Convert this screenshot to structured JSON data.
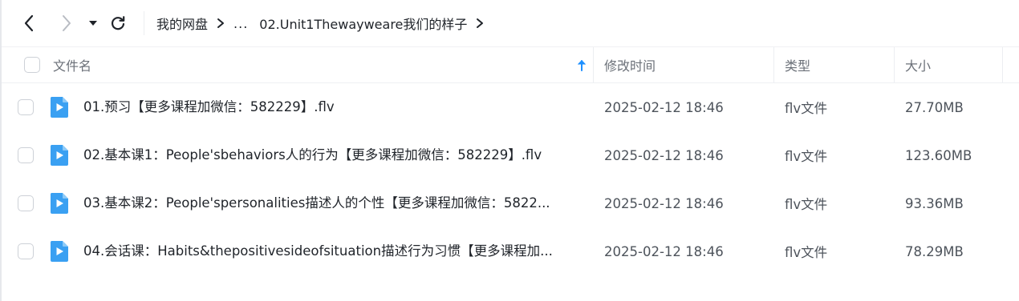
{
  "toolbar": {
    "back_icon": "chevron-left-icon",
    "forward_icon": "chevron-right-icon",
    "history_icon": "caret-down-icon",
    "refresh_icon": "refresh-icon"
  },
  "breadcrumb": {
    "root": "我的网盘",
    "ellipsis": "...",
    "current": "02.Unit1Thewayweare我们的样子"
  },
  "table": {
    "columns": {
      "name": "文件名",
      "modified": "修改时间",
      "type": "类型",
      "size": "大小"
    },
    "sort": {
      "column": "name",
      "direction": "ascending",
      "icon": "arrow-up-icon"
    },
    "rows": [
      {
        "name": "01.预习【更多课程加微信：582229】.flv",
        "modified": "2025-02-12 18:46",
        "type": "flv文件",
        "size": "27.70MB",
        "icon": "video-file-icon"
      },
      {
        "name": "02.基本课1：People'sbehaviors人的行为【更多课程加微信：582229】.flv",
        "modified": "2025-02-12 18:46",
        "type": "flv文件",
        "size": "123.60MB",
        "icon": "video-file-icon"
      },
      {
        "name": "03.基本课2：People'spersonalities描述人的个性【更多课程加微信：5822...",
        "modified": "2025-02-12 18:46",
        "type": "flv文件",
        "size": "93.36MB",
        "icon": "video-file-icon"
      },
      {
        "name": "04.会话课：Habits&thepositivesideofsituation描述行为习惯【更多课程加...",
        "modified": "2025-02-12 18:46",
        "type": "flv文件",
        "size": "78.29MB",
        "icon": "video-file-icon"
      }
    ]
  },
  "colors": {
    "accent": "#1e90ff",
    "file_icon": "#3aa0f2",
    "text_primary": "#1f2329",
    "text_secondary": "#6b7078",
    "divider": "#eceef1"
  }
}
